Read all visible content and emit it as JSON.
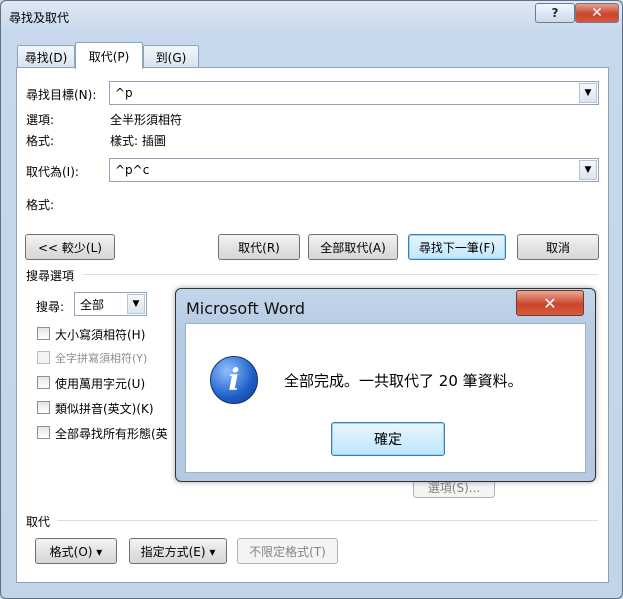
{
  "window": {
    "title": "尋找及取代",
    "help": "?",
    "close": "✕"
  },
  "tabs": [
    {
      "label": "尋找(D)"
    },
    {
      "label": "取代(P)"
    },
    {
      "label": "到(G)"
    }
  ],
  "find": {
    "label": "尋找目標(N):",
    "value": "^p",
    "options_label": "選項:",
    "options_value": "全半形須相符",
    "format_label": "格式:",
    "format_value": "樣式: 插圖"
  },
  "replace": {
    "label": "取代為(I):",
    "value": "^p^c",
    "format_label": "格式:"
  },
  "buttons": {
    "less": "<< 較少(L)",
    "replace": "取代(R)",
    "replace_all": "全部取代(A)",
    "find_next": "尋找下一筆(F)",
    "cancel": "取消"
  },
  "search_options": {
    "heading": "搜尋選項",
    "search_label": "搜尋:",
    "search_value": "全部",
    "checkboxes": [
      {
        "label": "大小寫須相符(H)",
        "enabled": true
      },
      {
        "label": "全字拼寫須相符(Y)",
        "enabled": false
      },
      {
        "label": "使用萬用字元(U)",
        "enabled": true
      },
      {
        "label": "類似拼音(英文)(K)",
        "enabled": true
      },
      {
        "label": "全部尋找所有形態(英",
        "enabled": true
      }
    ],
    "partial_button": "選項(S)..."
  },
  "replace_section": {
    "heading": "取代",
    "format_btn": "格式(O) ▾",
    "special_btn": "指定方式(E) ▾",
    "no_format_btn": "不限定格式(T)"
  },
  "dialog": {
    "title": "Microsoft Word",
    "close": "✕",
    "icon": "info-icon",
    "message": "全部完成。一共取代了 20 筆資料。",
    "ok": "確定"
  }
}
